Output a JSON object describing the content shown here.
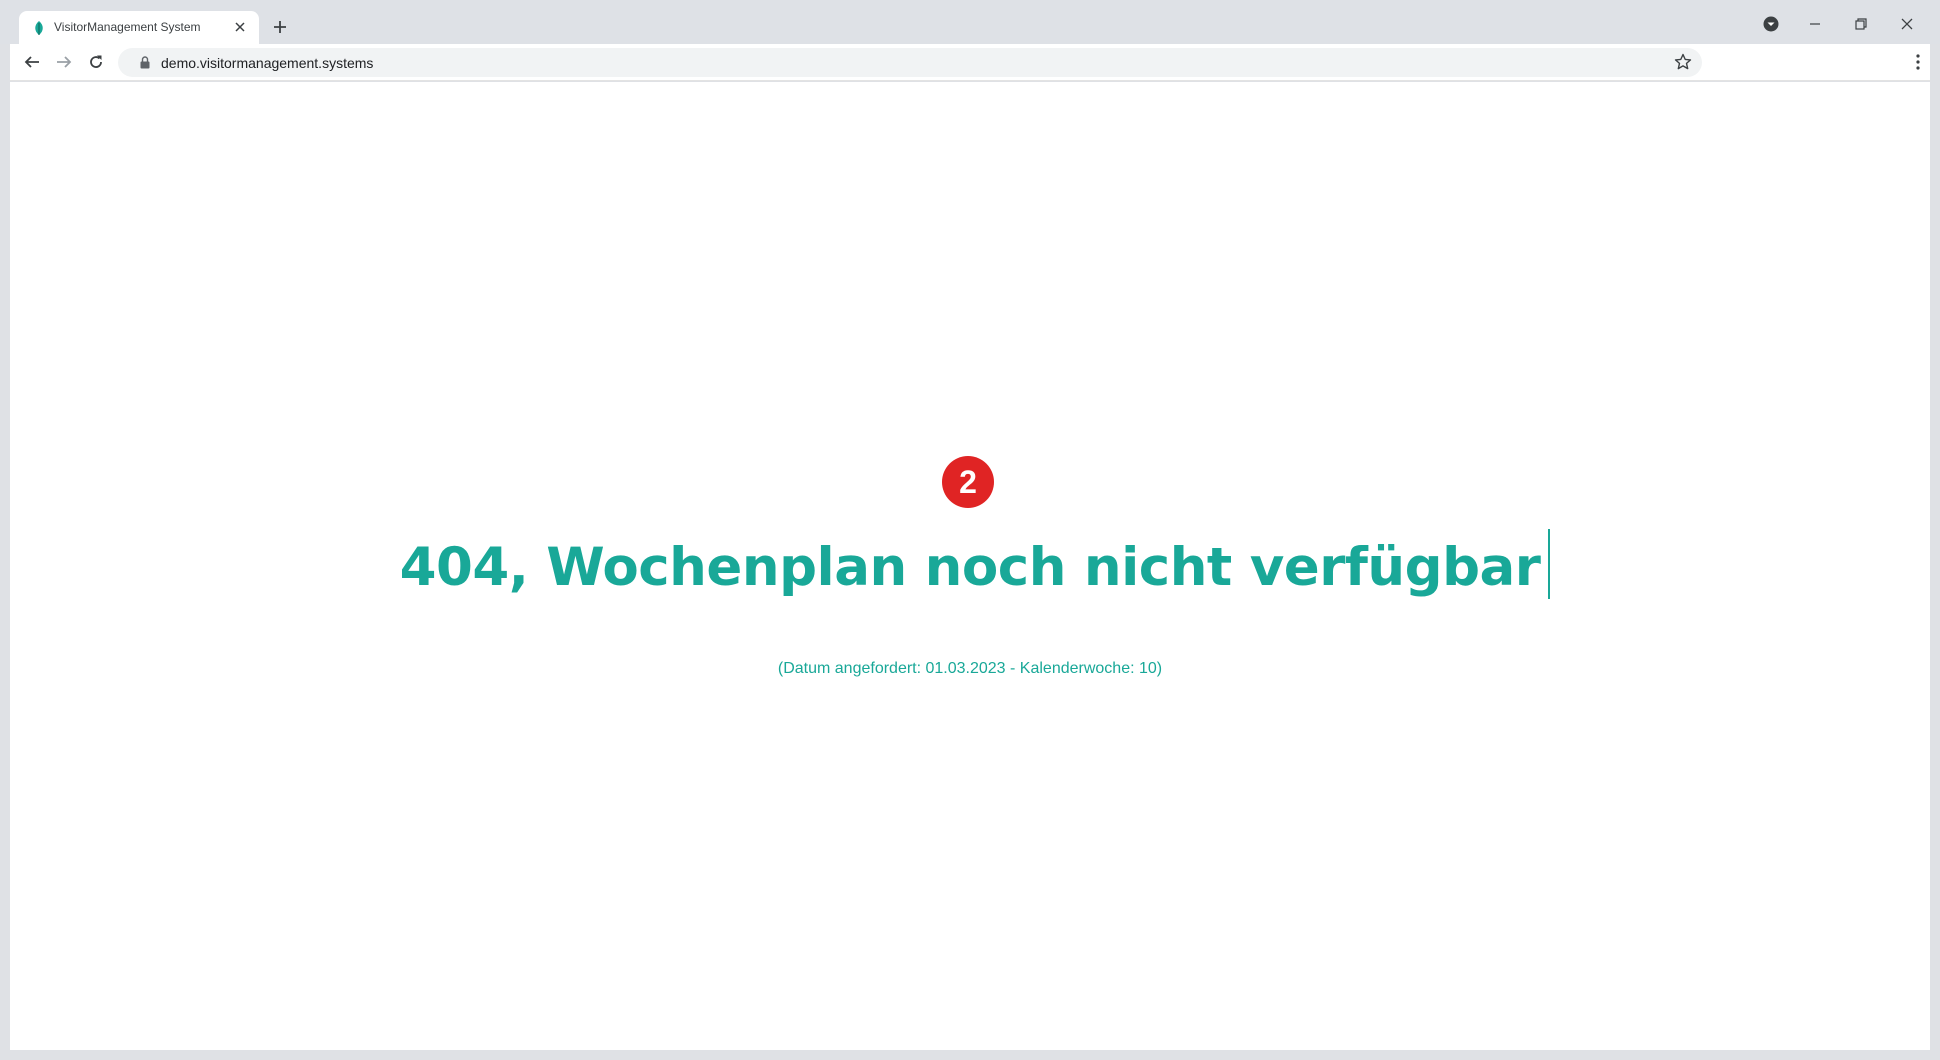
{
  "browser": {
    "tab": {
      "title": "VisitorManagement System",
      "favicon": "teal-leaf-icon"
    },
    "address_bar": {
      "url": "demo.visitormanagement.systems"
    },
    "icons": {
      "back": "arrow-left-icon",
      "forward": "arrow-right-icon",
      "reload": "reload-icon",
      "lock": "lock-icon",
      "bookmark": "star-icon",
      "menu": "kebab-menu-icon",
      "new_tab": "plus-icon",
      "profile": "dropdown-circle-icon",
      "minimize": "minimize-icon",
      "restore": "restore-icon",
      "close": "close-icon"
    }
  },
  "page": {
    "badge_number": "2",
    "heading": "404, Wochenplan noch nicht verfügbar",
    "subtext": "(Datum angefordert: 01.03.2023 - Kalenderwoche: 10)"
  },
  "colors": {
    "accent": "#19a898",
    "badge": "#e02424"
  }
}
